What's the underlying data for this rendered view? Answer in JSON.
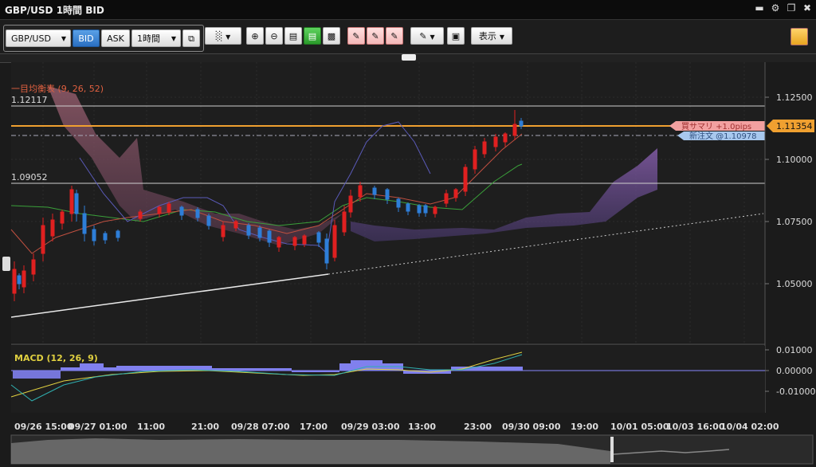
{
  "window": {
    "title": "GBP/USD 1時間 BID"
  },
  "toolbar": {
    "symbol": "GBP/USD",
    "bid_label": "BID",
    "ask_label": "ASK",
    "timeframe": "1時間",
    "display_label": "表示"
  },
  "chart": {
    "indicator_label": "一目均衡表 (9, 26, 52)",
    "high_line_label": "1.12117",
    "low_line_label": "1.09052",
    "price_ticks": [
      "1.12500",
      "1.10000",
      "1.07500",
      "1.05000"
    ],
    "current_price": "1.11354",
    "position_tag": "買サマリ +1.0pips",
    "order_tag": "新注文 @1.10978",
    "time_ticks": [
      "09/26 15:00",
      "09/27 01:00",
      "11:00",
      "21:00",
      "09/28 07:00",
      "17:00",
      "09/29 03:00",
      "13:00",
      "23:00",
      "09/30 09:00",
      "19:00",
      "10/01 05:00",
      "10/03 16:00",
      "10/04 02:00"
    ]
  },
  "macd": {
    "label": "MACD (12, 26, 9)",
    "ticks": [
      "0.01000",
      "0.00000",
      "-0.01000"
    ]
  },
  "colors": {
    "bull": "#e02020",
    "bear": "#2e7ed8",
    "price_line": "#f0a030",
    "cloud_up": "#8a5a8a",
    "cloud_dn": "#7a4a9a"
  }
}
